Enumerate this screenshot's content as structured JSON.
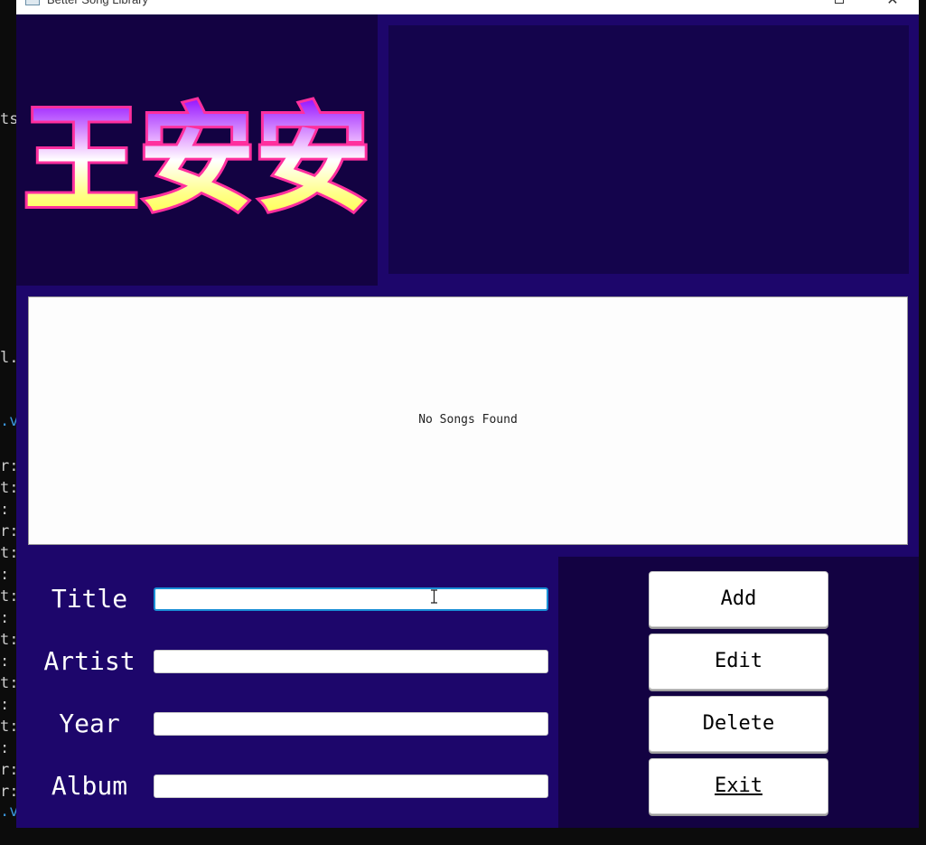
{
  "window": {
    "title": "Better Song Library"
  },
  "logo": {
    "text": "王安安"
  },
  "song_list": {
    "empty_message": "No Songs Found"
  },
  "form": {
    "fields": [
      {
        "label": "Title",
        "value": "",
        "focused": true
      },
      {
        "label": "Artist",
        "value": ""
      },
      {
        "label": "Year",
        "value": ""
      },
      {
        "label": "Album",
        "value": ""
      }
    ]
  },
  "buttons": {
    "add": "Add",
    "edit": "Edit",
    "delete": "Delete",
    "exit": "Exit"
  },
  "terminal": {
    "lines": [
      "ts",
      "l.",
      ".v",
      "r:",
      "t:",
      ":",
      "r:",
      "t:",
      ":",
      "t:",
      ":",
      "t:",
      ":",
      "t:",
      ":",
      "t:",
      ":",
      "r:",
      "r:",
      ".v"
    ]
  },
  "colors": {
    "window_bg": "#1d066b",
    "panel_dark": "#130242",
    "art_panel": "#14044c",
    "logo_pink": "#ff3aa8",
    "logo_purple": "#b000ff",
    "logo_yellow": "#ffff66"
  }
}
